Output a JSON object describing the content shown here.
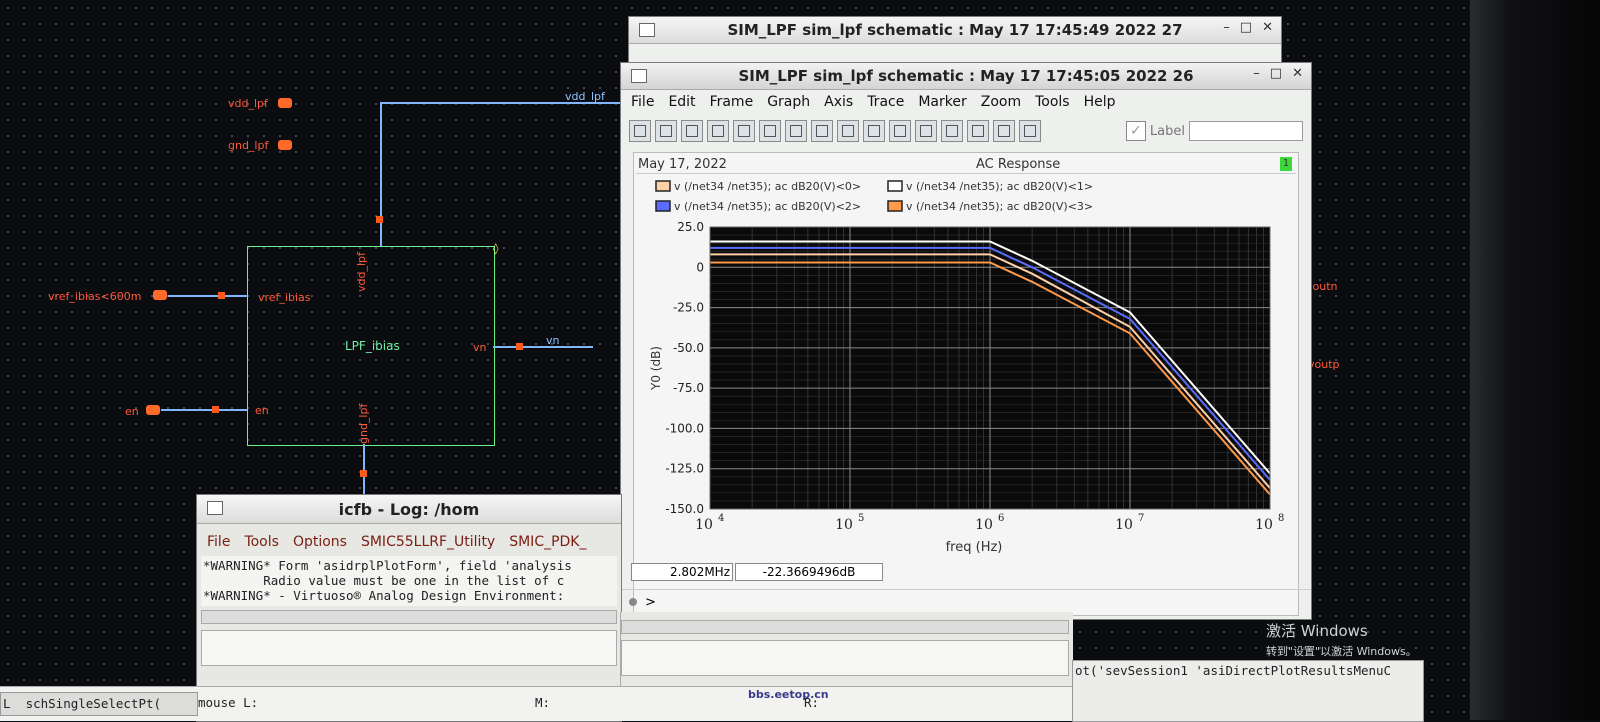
{
  "schematic": {
    "pins": {
      "vdd": "vdd_lpf",
      "gnd": "gnd_lpf",
      "vref": "vref_ibias<600m",
      "en": "en",
      "voutn": "voutn",
      "voutp": "voutp"
    },
    "wire_labels": {
      "vdd": "vdd_lpf",
      "vn": "vn"
    },
    "instance": {
      "name": "LPF_ibias",
      "pin_vref": "vref_ibias",
      "pin_vdd": "vdd_lpf",
      "pin_gnd": "gnd_lpf",
      "pin_en": "en",
      "pin_vn": "vn"
    }
  },
  "window_back": {
    "title": "SIM_LPF sim_lpf schematic : May 17 17:45:49 2022 27"
  },
  "window_plot": {
    "title": "SIM_LPF sim_lpf schematic : May 17 17:45:05 2022 26",
    "menu": [
      "File",
      "Edit",
      "Frame",
      "Graph",
      "Axis",
      "Trace",
      "Marker",
      "Zoom",
      "Tools",
      "Help"
    ],
    "toolbar_label": "Label",
    "date": "May 17, 2022",
    "plot_title": "AC Response",
    "subwin_badge": "1",
    "status_freq": "2.802MHz",
    "status_value": "-22.3669496dB",
    "prompt": ">"
  },
  "chart_data": {
    "type": "line",
    "title": "AC Response",
    "xlabel": "freq (Hz)",
    "ylabel": "Y0 (dB)",
    "xscale": "log",
    "xlim": [
      10000,
      100000000
    ],
    "ylim": [
      -150,
      25
    ],
    "yticks": [
      "25.0",
      "0",
      "-25.0",
      "-50.0",
      "-75.0",
      "-100.0",
      "-125.0",
      "-150.0"
    ],
    "xtick_mant": [
      "10",
      "10",
      "10",
      "10",
      "10"
    ],
    "xtick_exp": [
      "4",
      "5",
      "6",
      "7",
      "8"
    ],
    "legend_placement": "top-left",
    "grid": true,
    "series": [
      {
        "name": "v (/net34 /net35); ac dB20(V)<0>",
        "color": "#ffd0a8",
        "x": [
          10000,
          100000,
          1000000,
          2000000,
          10000000,
          100000000
        ],
        "y": [
          8,
          8,
          8,
          -4,
          -37,
          -137
        ]
      },
      {
        "name": "v (/net34 /net35); ac dB20(V)<1>",
        "color": "#ffffff",
        "x": [
          10000,
          100000,
          1000000,
          2000000,
          10000000,
          100000000
        ],
        "y": [
          16,
          16,
          16,
          4,
          -28,
          -128
        ]
      },
      {
        "name": "v (/net34 /net35); ac dB20(V)<2>",
        "color": "#5a6cff",
        "x": [
          10000,
          100000,
          1000000,
          2000000,
          10000000,
          100000000
        ],
        "y": [
          12,
          12,
          12,
          0,
          -32,
          -132
        ]
      },
      {
        "name": "v (/net34 /net35); ac dB20(V)<3>",
        "color": "#ff9a4a",
        "x": [
          10000,
          100000,
          1000000,
          2000000,
          10000000,
          100000000
        ],
        "y": [
          3,
          3,
          3,
          -9,
          -41,
          -141
        ]
      }
    ]
  },
  "log_window": {
    "title": "icfb - Log: /hom",
    "menu": [
      "File",
      "Tools",
      "Options",
      "SMIC55LLRF_Utility",
      "SMIC_PDK_"
    ],
    "lines": [
      "*WARNING* Form 'asidrplPlotForm', field 'analysis",
      "        Radio value must be one in the list of c",
      "*WARNING* - Virtuoso® Analog Design Environment:"
    ],
    "mouse_l": "mouse L:",
    "mouse_m": "M:",
    "mouse_r": "R:"
  },
  "cmd_fragments": {
    "left": "L  schSingleSelectPt(",
    "right": "ot('sevSession1 'asiDirectPlotResultsMenuC"
  },
  "os_watermark": {
    "line1": "激活 Windows",
    "line2": "转到\"设置\"以激活 Windows。"
  },
  "site_watermark": "bbs.eetop.cn"
}
